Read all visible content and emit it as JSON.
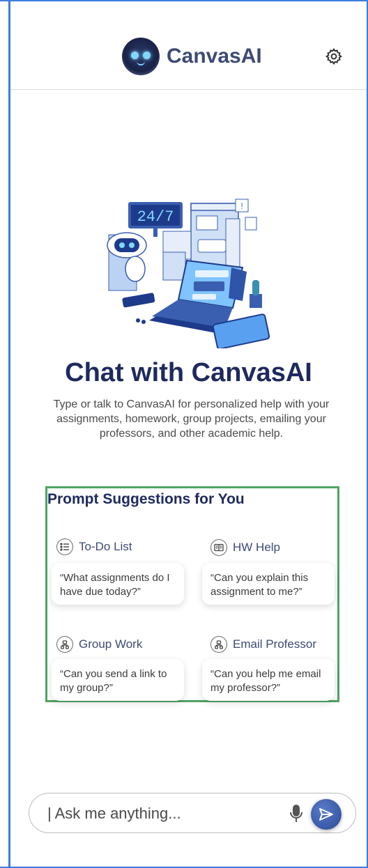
{
  "header": {
    "app_name": "CanvasAI"
  },
  "hero": {
    "badge_text": "24/7",
    "title": "Chat with CanvasAI",
    "subtitle": "Type or talk to CanvasAI for personalized help with your assignments, homework, group projects, emailing your professors, and other academic help."
  },
  "suggestions": {
    "heading": "Prompt Suggestions for You",
    "items": [
      {
        "label": "To-Do List",
        "icon": "list-icon",
        "prompt": "“What assignments do I have due today?”"
      },
      {
        "label": "HW Help",
        "icon": "book-icon",
        "prompt": "“Can you explain this assignment to me?”"
      },
      {
        "label": "Group Work",
        "icon": "group-icon",
        "prompt": "“Can you send a link to my group?”"
      },
      {
        "label": "Email Professor",
        "icon": "group-icon",
        "prompt": "“Can you help me email my professor?”"
      }
    ]
  },
  "composer": {
    "placeholder": "| Ask me anything..."
  },
  "colors": {
    "brand_navy": "#1e2a5e",
    "send_blue": "#2b4a96",
    "highlight_green": "#4fa463",
    "frame_blue": "#3b7ddd"
  }
}
